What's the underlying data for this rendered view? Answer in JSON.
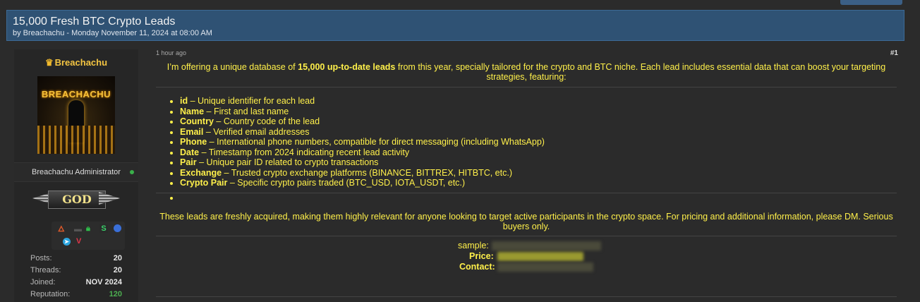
{
  "thread": {
    "title": "15,000 Fresh BTC Crypto Leads",
    "byline": "by Breachachu - Monday November 11, 2024 at 08:00 AM"
  },
  "user": {
    "name": "Breachachu",
    "crown_icon": "crown-icon",
    "avatar_text": "BREACHACHU",
    "role_line": "Breachachu Administrator",
    "rank_badge": "GOD",
    "stats": [
      {
        "label": "Posts:",
        "value": "20"
      },
      {
        "label": "Threads:",
        "value": "20"
      },
      {
        "label": "Joined:",
        "value": "NOV 2024"
      },
      {
        "label": "Reputation:",
        "value": "120"
      }
    ]
  },
  "post": {
    "time": "1 hour ago",
    "number": "#1",
    "intro_pre": "I’m offering a unique database of ",
    "intro_bold": "15,000 up-to-date leads",
    "intro_post": " from this year, specially tailored for the crypto and BTC niche. Each lead includes essential data that can boost your targeting strategies, featuring:",
    "fields": [
      {
        "name": "id",
        "desc": " – Unique identifier for each lead"
      },
      {
        "name": "Name",
        "desc": " – First and last name"
      },
      {
        "name": "Country",
        "desc": " – Country code of the lead"
      },
      {
        "name": "Email",
        "desc": " – Verified email addresses"
      },
      {
        "name": "Phone",
        "desc": " – International phone numbers, compatible for direct messaging (including WhatsApp)"
      },
      {
        "name": "Date",
        "desc": " – Timestamp from 2024 indicating recent lead activity"
      },
      {
        "name": "Pair",
        "desc": " – Unique pair ID related to crypto transactions"
      },
      {
        "name": "Exchange",
        "desc": " – Trusted crypto exchange platforms (BINANCE, BITTREX, HITBTC, etc.)"
      },
      {
        "name": "Crypto Pair",
        "desc": " – Specific crypto pairs traded (BTC_USD, IOTA_USDT, etc.)"
      }
    ],
    "outro": "These leads are freshly acquired, making them highly relevant for anyone looking to target active participants in the crypto space. For pricing and additional information, please DM. Serious buyers only.",
    "sample_label": "sample:",
    "price_label": "Price:",
    "contact_label": "Contact:"
  },
  "colors": {
    "accent_yellow": "#fff04a",
    "header_blue": "#2f5274",
    "online_green": "#3ab04a"
  }
}
